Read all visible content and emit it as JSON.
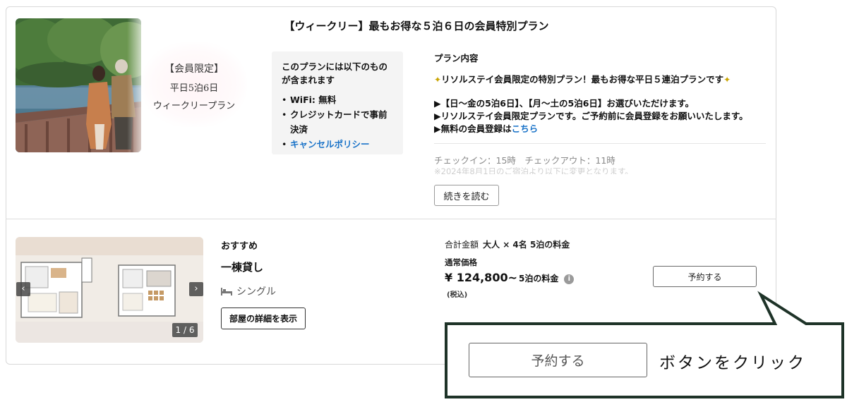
{
  "plan": {
    "title": "【ウィークリー】最もお得な５泊６日の会員特別プラン",
    "badge": {
      "line1": "【会員限定】",
      "line2": "平日5泊6日",
      "line3": "ウィークリープラン"
    },
    "includes": {
      "title": "このプランには以下のものが含まれます",
      "items": [
        "WiFi: 無料",
        "クレジットカードで事前決済",
        "キャンセルポリシー"
      ]
    },
    "content": {
      "title": "プラン内容",
      "lead": "リソルステイ会員限定の特別プラン！最もお得な平日５連泊プランです",
      "line1": "▶【日〜金の5泊6日】、【月〜土の5泊6日】お選びいただけます。",
      "line2": "▶リソルステイ会員限定プランです。ご予約前に会員登録をお願いいたします。",
      "line3_text": "▶無料の会員登録は",
      "line3_link": "こちら",
      "checkin": "チェックイン：15時　チェックアウト：11時",
      "faded": "※2024年8月1日のご宿泊より以下に変更となります。",
      "read_more": "続きを読む"
    }
  },
  "room": {
    "recommend": "おすすめ",
    "name": "一棟貸し",
    "bed": "シングル",
    "details_button": "部屋の詳細を表示",
    "photo_counter": "1 / 6",
    "prev_arrow": "‹",
    "next_arrow": "›"
  },
  "pricing": {
    "total_label": "合計金額",
    "total_sub": "大人 × 4名 5泊の料金",
    "normal_price_label": "通常価格",
    "price": "¥ 124,800~",
    "price_nights": "5泊の料金",
    "info": "i",
    "tax": "(税込)",
    "reserve_button": "予約する"
  },
  "callout": {
    "button": "予約する",
    "text": "ボタンをクリック"
  },
  "colors": {
    "link": "#1a73c8",
    "callout_border": "#1e3328"
  }
}
